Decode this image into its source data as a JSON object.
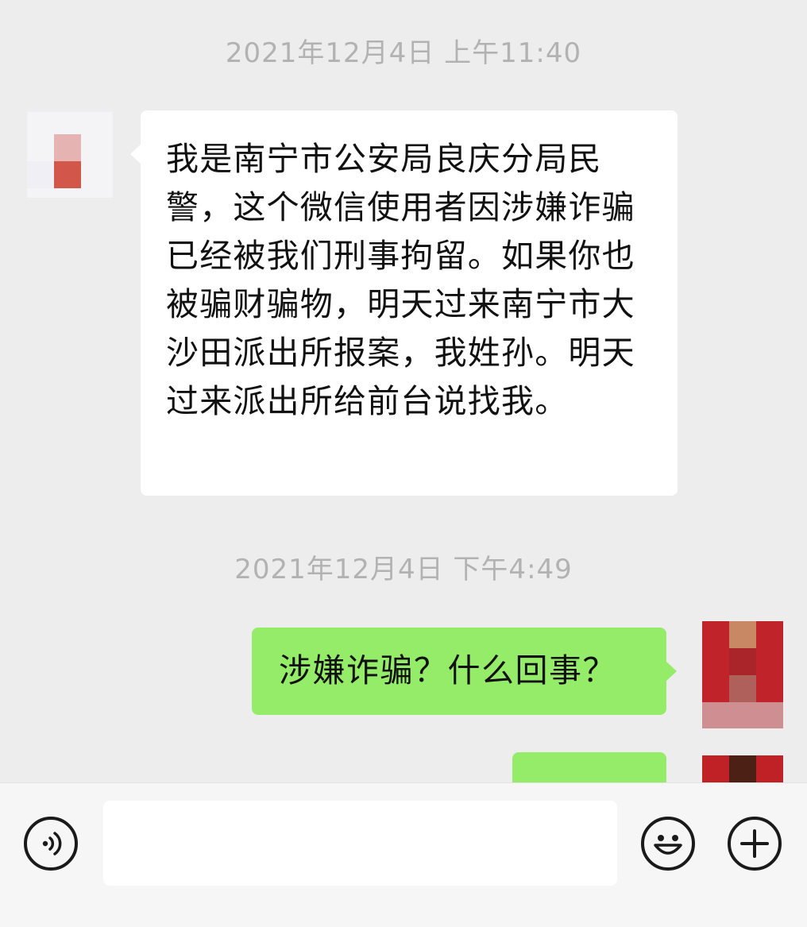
{
  "messages": [
    {
      "timestamp": "2021年12月4日 上午11:40",
      "sender": "other",
      "text": "我是南宁市公安局良庆分局民警，这个微信使用者因涉嫌诈骗已经被我们刑事拘留。如果你也被骗财骗物，明天过来南宁市大沙田派出所报案，我姓孙。明天过来派出所给前台说找我。"
    },
    {
      "timestamp": "2021年12月4日 下午4:49",
      "sender": "self",
      "text": "涉嫌诈骗？什么回事？"
    }
  ],
  "input_bar": {
    "text_value": "",
    "voice_icon": "voice-icon",
    "emoji_icon": "emoji-smile-icon",
    "plus_icon": "plus-icon"
  },
  "colors": {
    "chat_background": "#ededed",
    "incoming_bubble": "#ffffff",
    "outgoing_bubble": "#95ec69",
    "timestamp_text": "#b2b2b2",
    "input_bar_background": "#f6f6f6"
  }
}
